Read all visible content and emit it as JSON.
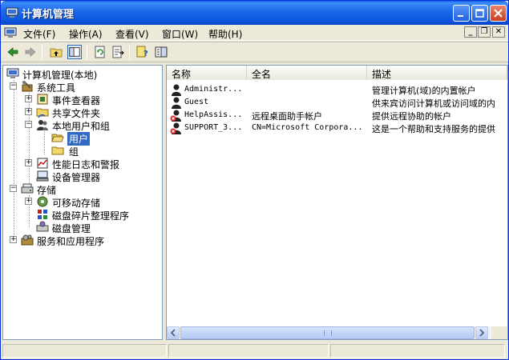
{
  "window": {
    "title": "计算机管理"
  },
  "menu": {
    "items": [
      {
        "name": "menu-file",
        "label": "文件(F)"
      },
      {
        "name": "menu-action",
        "label": "操作(A)"
      },
      {
        "name": "menu-view",
        "label": "查看(V)"
      },
      {
        "name": "menu-window",
        "label": "窗口(W)"
      },
      {
        "name": "menu-help",
        "label": "帮助(H)"
      }
    ],
    "mdi": {
      "minimize": "_",
      "restore": "❐",
      "close": "✕"
    }
  },
  "toolbar": {
    "icons": [
      "back-arrow-icon",
      "forward-arrow-icon",
      "up-folder-icon",
      "show-hide-tree-icon",
      "refresh-icon",
      "export-list-icon",
      "help-icon",
      "console-tree-icon"
    ]
  },
  "tree": {
    "nodes": [
      {
        "label": "计算机管理(本地)",
        "icon": "computer-management-icon"
      },
      {
        "label": "系统工具",
        "icon": "system-tools-icon"
      },
      {
        "label": "事件查看器",
        "icon": "event-viewer-icon"
      },
      {
        "label": "共享文件夹",
        "icon": "shared-folders-icon"
      },
      {
        "label": "本地用户和组",
        "icon": "local-users-groups-icon"
      },
      {
        "label": "用户",
        "icon": "folder-open-icon",
        "selected": true
      },
      {
        "label": "组",
        "icon": "folder-icon"
      },
      {
        "label": "性能日志和警报",
        "icon": "performance-logs-icon"
      },
      {
        "label": "设备管理器",
        "icon": "device-manager-icon"
      },
      {
        "label": "存储",
        "icon": "storage-icon"
      },
      {
        "label": "可移动存储",
        "icon": "removable-storage-icon"
      },
      {
        "label": "磁盘碎片整理程序",
        "icon": "defragmenter-icon"
      },
      {
        "label": "磁盘管理",
        "icon": "disk-management-icon"
      },
      {
        "label": "服务和应用程序",
        "icon": "services-applications-icon"
      }
    ]
  },
  "list": {
    "columns": [
      "名称",
      "全名",
      "描述"
    ],
    "rows": [
      {
        "name": "Administr...",
        "fullname": "",
        "desc": "管理计算机(域)的内置帐户",
        "disabled": false
      },
      {
        "name": "Guest",
        "fullname": "",
        "desc": "供来宾访问计算机或访问域的内",
        "disabled": false
      },
      {
        "name": "HelpAssis...",
        "fullname": "远程桌面助手帐户",
        "desc": "提供远程协助的帐户",
        "disabled": true
      },
      {
        "name": "SUPPORT_3...",
        "fullname": "CN=Microsoft Corpora...",
        "desc": "这是一个帮助和支持服务的提供",
        "disabled": true
      }
    ]
  },
  "colors": {
    "title_bar": "#0A55DA",
    "selection": "#316AC5",
    "disabled_user_badge": "#D62828"
  }
}
